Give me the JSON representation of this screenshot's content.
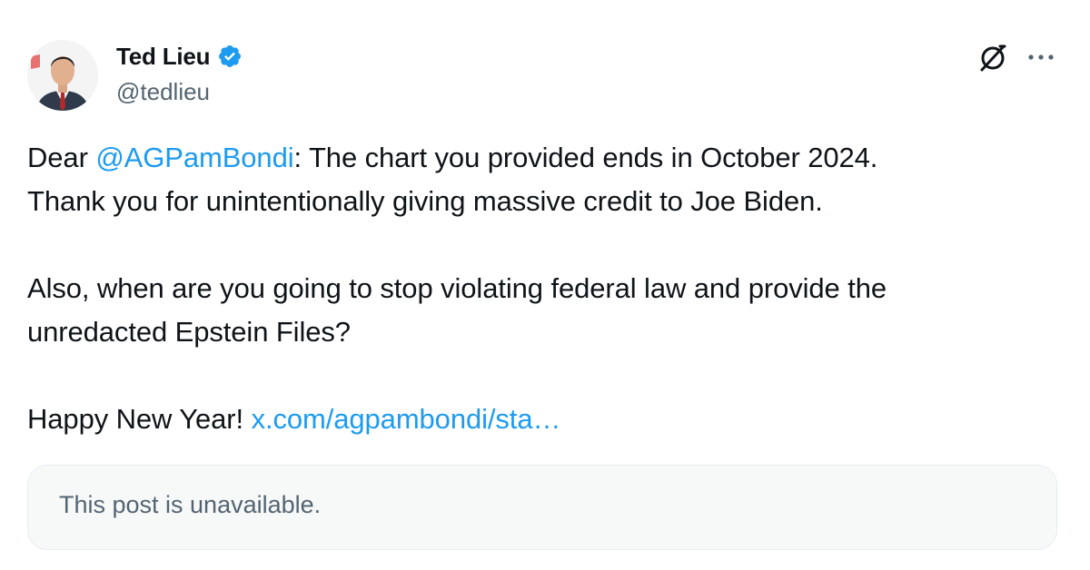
{
  "author": {
    "display_name": "Ted Lieu",
    "handle": "@tedlieu",
    "verified": true,
    "verified_color": "#1d9bf0"
  },
  "icons": {
    "verified": "verified-badge-icon",
    "grok": "grok-icon",
    "more": "more-options-icon"
  },
  "post": {
    "line1_prefix": "Dear ",
    "mention": "@AGPamBondi",
    "line1_suffix": ": The chart you provided ends in October 2024.",
    "line2": "Thank you for unintentionally giving massive credit to Joe Biden.",
    "paragraph2_line1": "Also, when are you going to stop violating federal law and provide the",
    "paragraph2_line2": "unredacted Epstein Files?",
    "paragraph3_text": "Happy New Year! ",
    "paragraph3_link": "x.com/agpambondi/sta…",
    "link_color": "#1d9bf0"
  },
  "quote": {
    "text": "This post is unavailable."
  }
}
